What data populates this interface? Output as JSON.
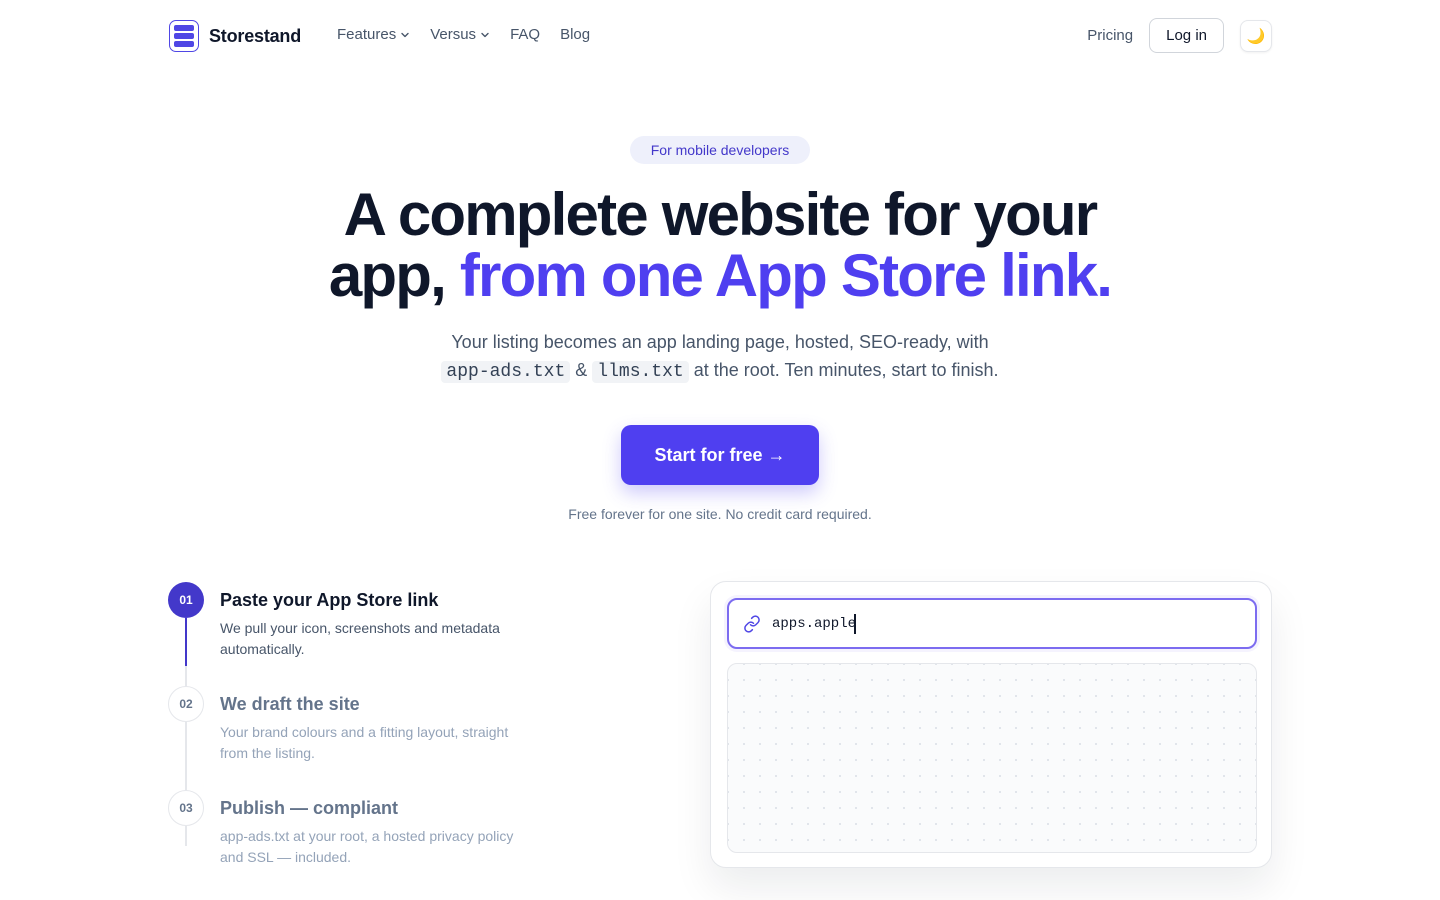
{
  "nav": {
    "brand": "Storestand",
    "links": [
      {
        "label": "Features",
        "dropdown": true
      },
      {
        "label": "Versus",
        "dropdown": true
      },
      {
        "label": "FAQ",
        "dropdown": false
      },
      {
        "label": "Blog",
        "dropdown": false
      }
    ],
    "pricing": "Pricing",
    "login": "Log in",
    "theme_icon": "🌙"
  },
  "hero": {
    "badge": "For mobile developers",
    "headline_line1": "A complete website for your",
    "headline_line2_plain": "app, ",
    "headline_line2_accent": "from one App Store link.",
    "sub_part1": "Your listing becomes an app landing page, hosted, SEO-ready, with",
    "sub_code1": "app-ads.txt",
    "sub_amp": "&",
    "sub_code2": "llms.txt",
    "sub_part2": "at the root. Ten minutes, start to finish.",
    "cta": "Start for free →",
    "note": "Free forever for one site. No credit card required."
  },
  "steps": [
    {
      "num": "01",
      "title": "Paste your App Store link",
      "desc": "We pull your icon, screenshots and metadata automatically.",
      "active": true
    },
    {
      "num": "02",
      "title": "We draft the site",
      "desc": "Your brand colours and a fitting layout, straight from the listing.",
      "active": false
    },
    {
      "num": "03",
      "title": "Publish — compliant",
      "desc": "app-ads.txt at your root, a hosted privacy policy and SSL — included.",
      "active": false
    }
  ],
  "preview": {
    "url_value": "apps.apple",
    "icon": "link-icon"
  },
  "colors": {
    "accent": "#4f3ff0",
    "accent_dark": "#4338ca",
    "text": "#0f172a",
    "muted": "#475569"
  }
}
